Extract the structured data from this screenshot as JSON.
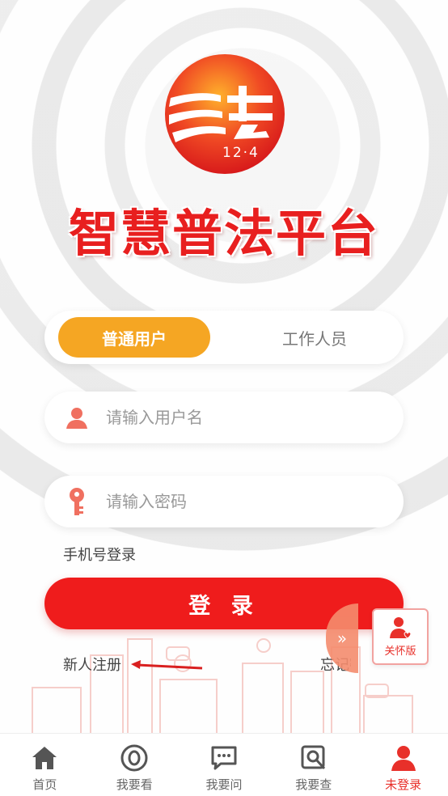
{
  "app": {
    "title": "智慧普法平台",
    "logo_text": "12·4"
  },
  "tabs": [
    {
      "label": "普通用户",
      "active": true
    },
    {
      "label": "工作人员",
      "active": false
    }
  ],
  "form": {
    "username_placeholder": "请输入用户名",
    "password_placeholder": "请输入密码",
    "phone_login_label": "手机号登录",
    "login_button": "登 录",
    "register_label": "新人注册",
    "forgot_label": "忘记密码"
  },
  "side": {
    "expand_icon": "»",
    "care_label": "关怀版"
  },
  "nav": [
    {
      "label": "首页",
      "icon": "home-icon",
      "active": false
    },
    {
      "label": "我要看",
      "icon": "view-icon",
      "active": false
    },
    {
      "label": "我要问",
      "icon": "chat-icon",
      "active": false
    },
    {
      "label": "我要查",
      "icon": "search-icon",
      "active": false
    },
    {
      "label": "未登录",
      "icon": "user-icon",
      "active": true
    }
  ],
  "colors": {
    "brand_red": "#ef1c1c",
    "tab_orange": "#f5a623",
    "icon_red": "#e8302a"
  }
}
